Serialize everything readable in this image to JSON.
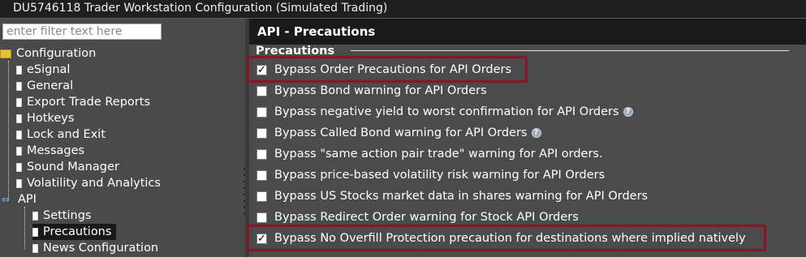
{
  "window": {
    "title": "DU5746118 Trader Workstation Configuration (Simulated Trading)"
  },
  "sidebar": {
    "filter_placeholder": "enter filter text here",
    "root": "Configuration",
    "items": [
      {
        "label": "eSignal",
        "icon": "document-icon"
      },
      {
        "label": "General",
        "icon": "document-icon"
      },
      {
        "label": "Export Trade Reports",
        "icon": "document-icon"
      },
      {
        "label": "Hotkeys",
        "icon": "document-icon"
      },
      {
        "label": "Lock and Exit",
        "icon": "document-icon"
      },
      {
        "label": "Messages",
        "icon": "document-icon"
      },
      {
        "label": "Sound Manager",
        "icon": "document-icon"
      },
      {
        "label": "Volatility and Analytics",
        "icon": "document-icon"
      },
      {
        "label": "API",
        "icon": "api-icon"
      }
    ],
    "api_children": [
      {
        "label": "Settings",
        "icon": "document-icon"
      },
      {
        "label": "Precautions",
        "icon": "document-icon",
        "selected": true
      },
      {
        "label": "News Configuration",
        "icon": "document-icon"
      }
    ]
  },
  "panel": {
    "header": "API - Precautions",
    "group_title": "Precautions",
    "options": [
      {
        "label": "Bypass Order Precautions for API Orders",
        "checked": true,
        "help": false,
        "highlighted": true
      },
      {
        "label": "Bypass Bond warning for API Orders",
        "checked": false,
        "help": false
      },
      {
        "label": "Bypass negative yield to worst confirmation for API Orders",
        "checked": false,
        "help": true
      },
      {
        "label": "Bypass Called Bond warning for API Orders",
        "checked": false,
        "help": true
      },
      {
        "label": "Bypass \"same action pair trade\" warning for API orders.",
        "checked": false,
        "help": false
      },
      {
        "label": "Bypass price-based volatility risk warning for API Orders",
        "checked": false,
        "help": false
      },
      {
        "label": "Bypass US Stocks market data in shares warning for API Orders",
        "checked": false,
        "help": false
      },
      {
        "label": "Bypass Redirect Order warning for Stock API Orders",
        "checked": false,
        "help": false
      },
      {
        "label": "Bypass No Overfill Protection precaution for destinations where implied natively",
        "checked": true,
        "help": false,
        "highlighted": true
      }
    ]
  },
  "colors": {
    "highlight": "#8b1526",
    "header_bg": "#1a1a1a",
    "panel_bg": "#4b4b4b"
  }
}
